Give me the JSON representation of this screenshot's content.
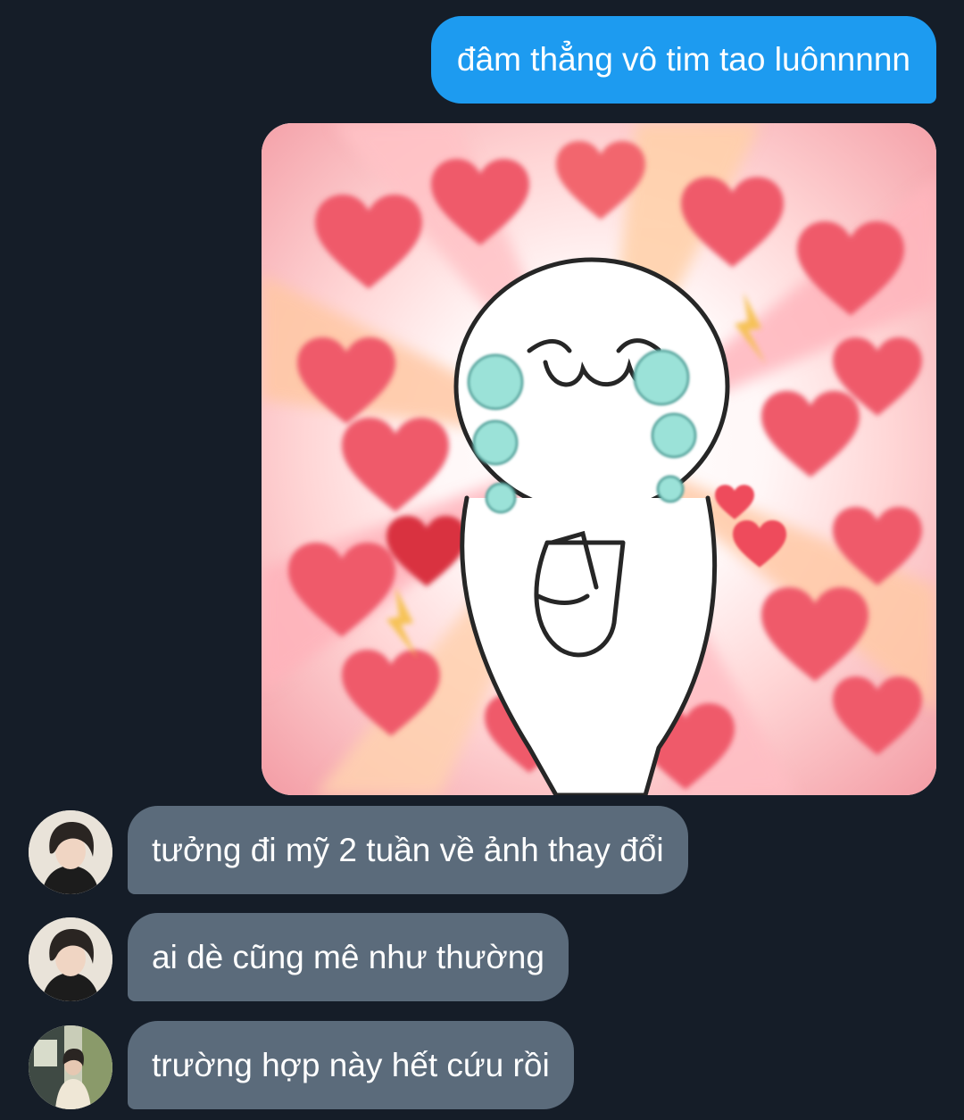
{
  "conversation": {
    "outgoing": [
      {
        "text": "đâm thẳng vô tim tao luônnnnn"
      }
    ],
    "incoming": [
      {
        "text": "tưởng đi mỹ 2 tuần về ảnh thay đổi"
      },
      {
        "text": "ai dè cũng mê như thường"
      },
      {
        "text": "trường hợp này hết cứu rồi"
      }
    ]
  },
  "colors": {
    "background": "#151d28",
    "outgoing_bubble": "#1d9bf0",
    "incoming_bubble": "#5b6b7b",
    "text": "#ffffff"
  }
}
